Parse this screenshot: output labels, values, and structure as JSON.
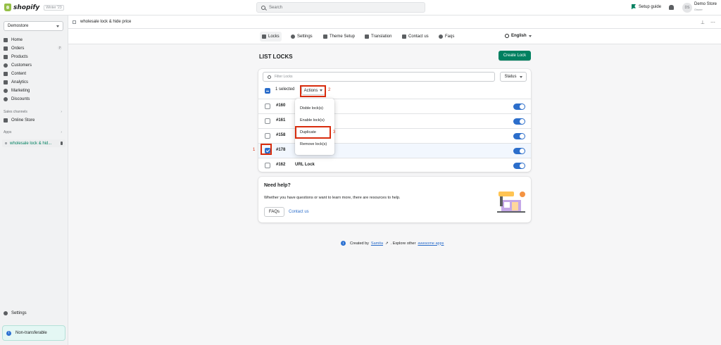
{
  "topbar": {
    "brand": "shopify",
    "edition": "Winter '23",
    "search_placeholder": "Search",
    "setup_guide": "Setup guide",
    "avatar_initials": "DS",
    "store_name": "Demo Store",
    "store_sub": "Owner"
  },
  "sidebar": {
    "store_select": "Demostore",
    "items": [
      {
        "label": "Home"
      },
      {
        "label": "Orders",
        "badge": "7"
      },
      {
        "label": "Products"
      },
      {
        "label": "Customers"
      },
      {
        "label": "Content"
      },
      {
        "label": "Analytics"
      },
      {
        "label": "Marketing"
      },
      {
        "label": "Discounts"
      }
    ],
    "sales_channels_label": "Sales channels",
    "online_store": "Online Store",
    "apps_label": "Apps",
    "app_item": "wholesale lock & hid...",
    "settings": "Settings",
    "nontransferable": "Non-transferable"
  },
  "breadcrumb": {
    "title": "wholesale lock & hide price"
  },
  "appnav": {
    "tabs": [
      "Locks",
      "Settings",
      "Theme Setup",
      "Translation",
      "Contact us",
      "Faqs"
    ],
    "language": "English"
  },
  "main": {
    "title": "LIST LOCKS",
    "create_button": "Create Lock",
    "filter_placeholder": "Filter Locks",
    "status_button": "Status",
    "selected_text": "1 selected",
    "actions_button": "Actions",
    "rows": [
      {
        "id": "#160",
        "name": "",
        "selected": false
      },
      {
        "id": "#161",
        "name": "",
        "selected": false
      },
      {
        "id": "#158",
        "name": "",
        "selected": false
      },
      {
        "id": "#178",
        "name": "",
        "selected": true
      },
      {
        "id": "#162",
        "name": "URL Lock",
        "selected": false
      }
    ],
    "dropdown": [
      "Disble lock(s)",
      "Enable lock(s)",
      "Duplicate",
      "Remove lock(s)"
    ],
    "annotations": [
      "1",
      "2",
      "3"
    ]
  },
  "help": {
    "title": "Need help?",
    "text": "Whether you have questions or want to learn more, there are resources to help.",
    "faqs_button": "FAQs",
    "contact_link": "Contact us"
  },
  "footer": {
    "created_by": "Created by",
    "samita": "Samita",
    "explore": ". Explore other",
    "awesome_apps": "awesome apps"
  },
  "colors": {
    "accent": "#008060",
    "primary_blue": "#2c6ecb",
    "annotation_red": "#d82c0d"
  }
}
